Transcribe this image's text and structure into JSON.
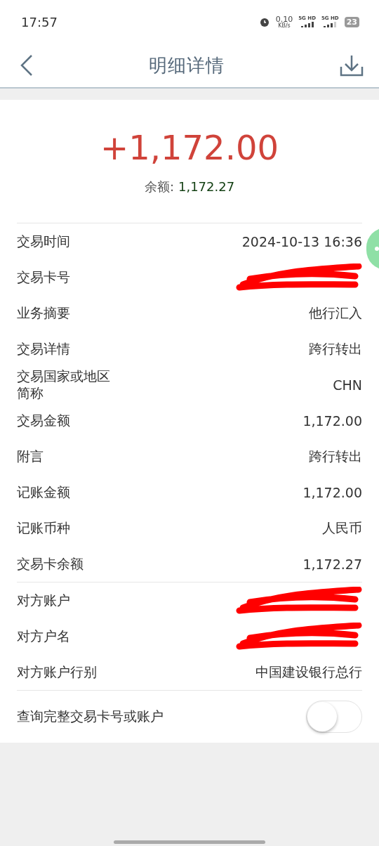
{
  "status_bar": {
    "time": "17:57",
    "speed": "0.10",
    "speed_unit": "KB/s",
    "networks": [
      "5G HD",
      "5G HD"
    ],
    "battery": "23"
  },
  "header": {
    "title": "明细详情"
  },
  "summary": {
    "amount": "+1,172.00",
    "balance_label": "余额:",
    "balance": "1,172.27"
  },
  "sections": [
    [
      {
        "label": "交易时间",
        "value": "2024-10-13 16:36",
        "kind": "text"
      },
      {
        "label": "交易卡号",
        "kind": "redacted"
      },
      {
        "label": "业务摘要",
        "value": "他行汇入",
        "kind": "text"
      },
      {
        "label": "交易详情",
        "value": "跨行转出",
        "kind": "text"
      },
      {
        "label": "交易国家或地区简称",
        "value": "CHN",
        "kind": "text"
      },
      {
        "label": "交易金额",
        "value": "1,172.00",
        "kind": "text"
      },
      {
        "label": "附言",
        "value": "跨行转出",
        "kind": "text"
      },
      {
        "label": "记账金额",
        "value": "1,172.00",
        "kind": "text"
      },
      {
        "label": "记账币种",
        "value": "人民币",
        "kind": "text"
      },
      {
        "label": "交易卡余额",
        "value": "1,172.27",
        "kind": "text"
      }
    ],
    [
      {
        "label": "对方账户",
        "kind": "redacted"
      },
      {
        "label": "对方户名",
        "kind": "redacted"
      },
      {
        "label": "对方账户行别",
        "value": "中国建设银行总行",
        "kind": "text"
      }
    ]
  ],
  "toggle": {
    "label": "查询完整交易卡号或账户",
    "on": false
  }
}
